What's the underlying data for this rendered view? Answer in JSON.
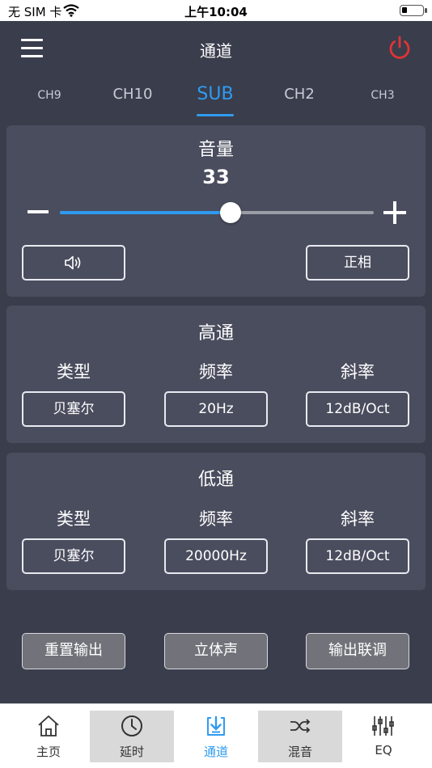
{
  "status_bar": {
    "carrier": "无 SIM 卡",
    "time": "上午10:04"
  },
  "header": {
    "title": "通道"
  },
  "tabs": [
    {
      "label": "CH9"
    },
    {
      "label": "CH10"
    },
    {
      "label": "SUB"
    },
    {
      "label": "CH2"
    },
    {
      "label": "CH3"
    }
  ],
  "volume": {
    "title": "音量",
    "value": "33",
    "slider_fraction": 0.545,
    "phase_label": "正相"
  },
  "highpass": {
    "title": "高通",
    "type_label": "类型",
    "freq_label": "频率",
    "slope_label": "斜率",
    "type_value": "贝塞尔",
    "freq_value": "20Hz",
    "slope_value": "12dB/Oct"
  },
  "lowpass": {
    "title": "低通",
    "type_label": "类型",
    "freq_label": "频率",
    "slope_label": "斜率",
    "type_value": "贝塞尔",
    "freq_value": "20000Hz",
    "slope_value": "12dB/Oct"
  },
  "actions": {
    "reset_label": "重置输出",
    "stereo_label": "立体声",
    "link_label": "输出联调"
  },
  "bottom_nav": [
    {
      "label": "主页",
      "icon": "home-icon"
    },
    {
      "label": "延时",
      "icon": "clock-icon"
    },
    {
      "label": "通道",
      "icon": "channel-download-icon"
    },
    {
      "label": "混音",
      "icon": "shuffle-icon"
    },
    {
      "label": "EQ",
      "icon": "equalizer-icon"
    }
  ],
  "colors": {
    "background": "#3a3d4c",
    "card": "#4a4d5e",
    "accent": "#2f9bf0",
    "power": "#e03434"
  }
}
